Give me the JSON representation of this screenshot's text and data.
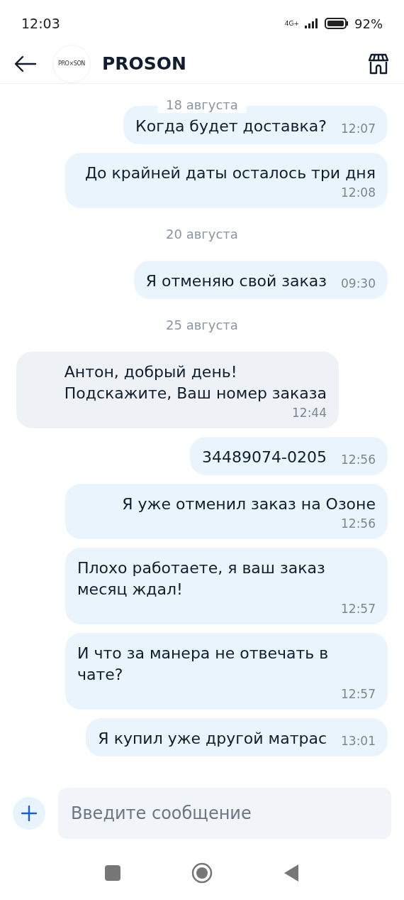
{
  "status_bar": {
    "time": "12:03",
    "network": "4G+",
    "battery": "92%"
  },
  "header": {
    "logo_text": "PRO×SON",
    "title": "PROSON"
  },
  "messages": [
    {
      "kind": "date",
      "text": "18 августа",
      "overlay": true
    },
    {
      "kind": "outgoing",
      "text": "Когда будет доставка?",
      "time": "12:07"
    },
    {
      "kind": "outgoing",
      "text": "До крайней даты осталось три дня",
      "time": "12:08"
    },
    {
      "kind": "date",
      "text": "20 августа",
      "overlay": false
    },
    {
      "kind": "outgoing",
      "text": "Я отменяю свой заказ",
      "time": "09:30"
    },
    {
      "kind": "date",
      "text": "25 августа",
      "overlay": false
    },
    {
      "kind": "incoming",
      "text": "Антон, добрый день!\nПодскажите, Ваш номер заказа",
      "time": "12:44"
    },
    {
      "kind": "outgoing",
      "text": "34489074-0205",
      "time": "12:56"
    },
    {
      "kind": "outgoing",
      "text": "Я уже отменил заказ на Озоне",
      "time": "12:56"
    },
    {
      "kind": "outgoing",
      "text": "Плохо работаете, я ваш заказ месяц ждал!",
      "time": "12:57"
    },
    {
      "kind": "outgoing",
      "text": "И что за манера не отвечать в чате?",
      "time": "12:57"
    },
    {
      "kind": "outgoing",
      "text": "Я купил уже другой матрас",
      "time": "13:01"
    }
  ],
  "composer": {
    "placeholder": "Введите сообщение"
  }
}
